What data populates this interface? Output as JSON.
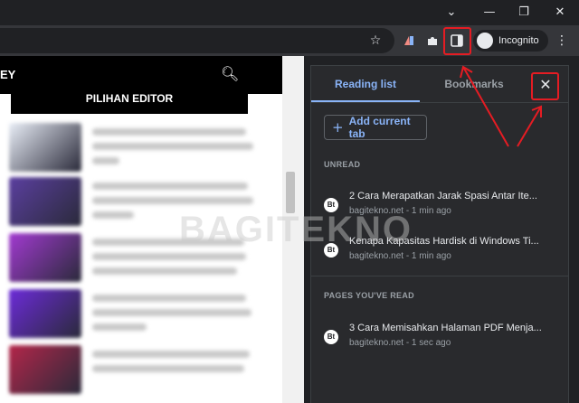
{
  "window": {
    "controls": [
      "⌄",
      "—",
      "❐",
      "✕"
    ]
  },
  "toolbar": {
    "star_icon": "star-icon",
    "extensions_icon": "puzzle-icon",
    "side_panel_icon": "side-panel-icon",
    "incognito_label": "Incognito",
    "menu_icon": "kebab-menu-icon"
  },
  "page": {
    "brand": "EY",
    "editor_label": "PILIHAN EDITOR",
    "thumb_colors": [
      "#e9eef7",
      "#5b3fa0",
      "#a23ad1",
      "#6c2bd9",
      "#b4264a"
    ]
  },
  "side_panel": {
    "tabs": [
      "Reading list",
      "Bookmarks"
    ],
    "add_button": "Add current tab",
    "sections": [
      {
        "heading": "UNREAD",
        "items": [
          {
            "title": "2 Cara Merapatkan Jarak Spasi Antar Ite...",
            "meta": "bagitekno.net - 1 min ago"
          },
          {
            "title": "Kenapa Kapasitas Hardisk di Windows Ti...",
            "meta": "bagitekno.net - 1 min ago"
          }
        ]
      },
      {
        "heading": "PAGES YOU'VE READ",
        "items": [
          {
            "title": "3 Cara Memisahkan Halaman PDF Menja...",
            "meta": "bagitekno.net - 1 sec ago"
          }
        ]
      }
    ]
  },
  "watermark": "BAGITEKNO",
  "colors": {
    "accent": "#8ab4f8",
    "highlight": "#e51c23"
  }
}
